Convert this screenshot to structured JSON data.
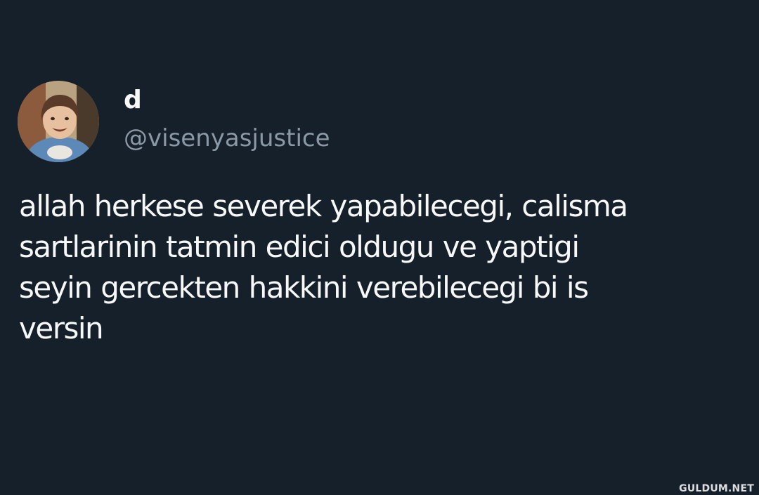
{
  "tweet": {
    "author": {
      "display_name": "d",
      "handle": "@visenyasjustice",
      "avatar_icon": "profile-photo-child"
    },
    "text_lines": [
      "allah herkese severek yapabilecegi, calisma",
      "sartlarinin tatmin edici oldugu ve yaptigi",
      "seyin gercekten hakkini verebilecegi bi is",
      "versin"
    ]
  },
  "watermark": {
    "text": "GULDUM.NET"
  },
  "colors": {
    "background": "#16202a",
    "primary_text": "#f7f9f9",
    "secondary_text": "#8b98a5"
  }
}
